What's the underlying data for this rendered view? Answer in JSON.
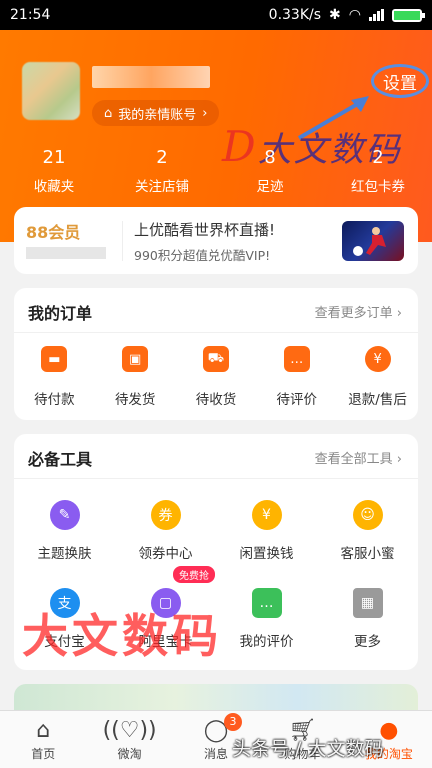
{
  "status_bar": {
    "time": "21:54",
    "speed": "0.33K/s"
  },
  "header": {
    "family_account": "我的亲情账号",
    "settings": "设置",
    "stats": [
      {
        "num": "21",
        "label": "收藏夹"
      },
      {
        "num": "2",
        "label": "关注店铺"
      },
      {
        "num": "8",
        "label": "足迹"
      },
      {
        "num": "2",
        "label": "红包卡券"
      }
    ],
    "watermark": "大文数码"
  },
  "member": {
    "badge": "88会员",
    "promo": "上优酷看世界杯直播!",
    "sub": "990积分超值兑优酷VIP!"
  },
  "orders": {
    "title": "我的订单",
    "more": "查看更多订单",
    "items": [
      {
        "label": "待付款",
        "icon": "wallet-icon"
      },
      {
        "label": "待发货",
        "icon": "package-icon"
      },
      {
        "label": "待收货",
        "icon": "truck-icon"
      },
      {
        "label": "待评价",
        "icon": "comment-icon"
      },
      {
        "label": "退款/售后",
        "icon": "refund-icon"
      }
    ]
  },
  "tools": {
    "title": "必备工具",
    "more": "查看全部工具",
    "items": [
      {
        "label": "主题换肤",
        "icon": "palette-icon",
        "color": "#8a5cf0"
      },
      {
        "label": "领券中心",
        "icon": "coupon-icon",
        "color": "#ffb400",
        "glyph": "券"
      },
      {
        "label": "闲置换钱",
        "icon": "yen-icon",
        "color": "#ffb400",
        "glyph": "¥"
      },
      {
        "label": "客服小蜜",
        "icon": "service-icon",
        "color": "#ffb400"
      },
      {
        "label": "支付宝",
        "icon": "alipay-icon",
        "color": "#1e8ff0",
        "glyph": "支"
      },
      {
        "label": "阿里宝卡",
        "icon": "sim-card-icon",
        "color": "#8a5cf0",
        "tag": "免费抢"
      },
      {
        "label": "我的评价",
        "icon": "review-icon",
        "color": "#3cc05a"
      },
      {
        "label": "更多",
        "icon": "grid-icon",
        "color": "#9a9a9a"
      }
    ]
  },
  "overlay_watermark": "大文数码",
  "tabbar": {
    "items": [
      {
        "label": "首页",
        "icon": "home-icon"
      },
      {
        "label": "微淘",
        "icon": "broadcast-icon"
      },
      {
        "label": "消息",
        "icon": "message-icon",
        "badge": "3"
      },
      {
        "label": "购物车",
        "icon": "cart-icon"
      },
      {
        "label": "我的淘宝",
        "icon": "profile-icon"
      }
    ],
    "watermark": "头条号 / 大文数码"
  }
}
